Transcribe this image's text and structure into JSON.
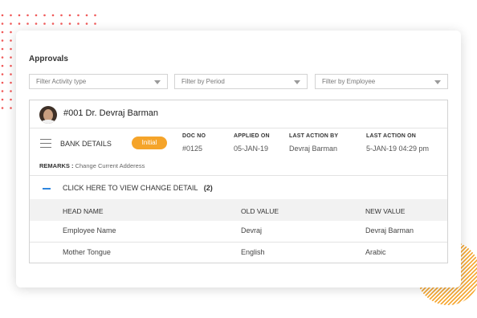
{
  "approvals": {
    "title": "Approvals"
  },
  "filters": [
    {
      "placeholder": "Filter Activity type"
    },
    {
      "placeholder": "Filter by Period"
    },
    {
      "placeholder": "Filter by Employee"
    }
  ],
  "request": {
    "employee": "#001 Dr. Devraj Barman",
    "section": "BANK DETAILS",
    "status": "Initial",
    "status_color": "#f5a42a",
    "meta": [
      {
        "label": "DOC NO",
        "value": "#0125"
      },
      {
        "label": "APPLIED ON",
        "value": "05-JAN-19"
      },
      {
        "label": "LAST ACTION BY",
        "value": "Devraj Barman"
      },
      {
        "label": "LAST ACTION ON",
        "value": "5-JAN-19 04:29 pm"
      }
    ],
    "remarks_label": "REMARKS :",
    "remarks": "Change Current Adderess",
    "toggle_label": "CLICK HERE TO VIEW CHANGE DETAIL",
    "change_count": "(2)"
  },
  "changes": {
    "headers": [
      "HEAD NAME",
      "OLD VALUE",
      "NEW VALUE"
    ],
    "rows": [
      [
        "Employee Name",
        "Devraj",
        "Devraj Barman"
      ],
      [
        "Mother Tongue",
        "English",
        "Arabic"
      ]
    ]
  }
}
